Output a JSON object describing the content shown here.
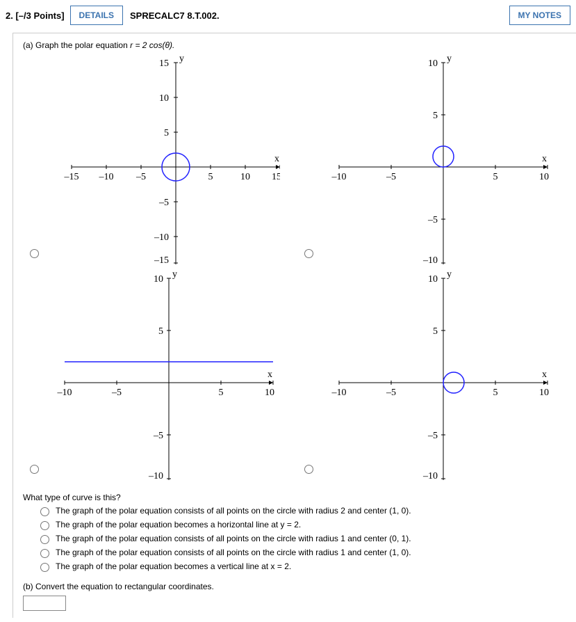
{
  "header": {
    "q_number": "2.",
    "points": "[–/3 Points]",
    "details": "DETAILS",
    "source": "SPRECALC7 8.T.002.",
    "mynotes": "MY NOTES"
  },
  "part_a_prefix": "(a) Graph the polar equation ",
  "part_a_equation": "r = 2 cos(θ).",
  "graphs": {
    "g1": {
      "ylabel": "y",
      "xlabel": "x",
      "x_ticks": [
        "–15",
        "–10",
        "–5",
        "5",
        "10",
        "15"
      ],
      "y_ticks": [
        "15",
        "10",
        "5",
        "–5",
        "–10",
        "–15"
      ]
    },
    "g2": {
      "ylabel": "y",
      "xlabel": "x",
      "x_ticks": [
        "–10",
        "–5",
        "5",
        "10"
      ],
      "y_ticks": [
        "10",
        "5",
        "–5",
        "–10"
      ]
    },
    "g3": {
      "ylabel": "y",
      "xlabel": "x",
      "x_ticks": [
        "–10",
        "–5",
        "5",
        "10"
      ],
      "y_ticks": [
        "10",
        "5",
        "–5",
        "–10"
      ]
    },
    "g4": {
      "ylabel": "y",
      "xlabel": "x",
      "x_ticks": [
        "–10",
        "–5",
        "5",
        "10"
      ],
      "y_ticks": [
        "10",
        "5",
        "–5",
        "–10"
      ]
    }
  },
  "curve_question": "What type of curve is this?",
  "mc": [
    "The graph of the polar equation consists of all points on the circle with radius 2 and center (1, 0).",
    "The graph of the polar equation becomes a horizontal line at y = 2.",
    "The graph of the polar equation consists of all points on the circle with radius 1 and center (0, 1).",
    "The graph of the polar equation consists of all points on the circle with radius 1 and center (1, 0).",
    "The graph of the polar equation becomes a vertical line at x = 2."
  ],
  "part_b": "(b) Convert the equation to rectangular coordinates."
}
